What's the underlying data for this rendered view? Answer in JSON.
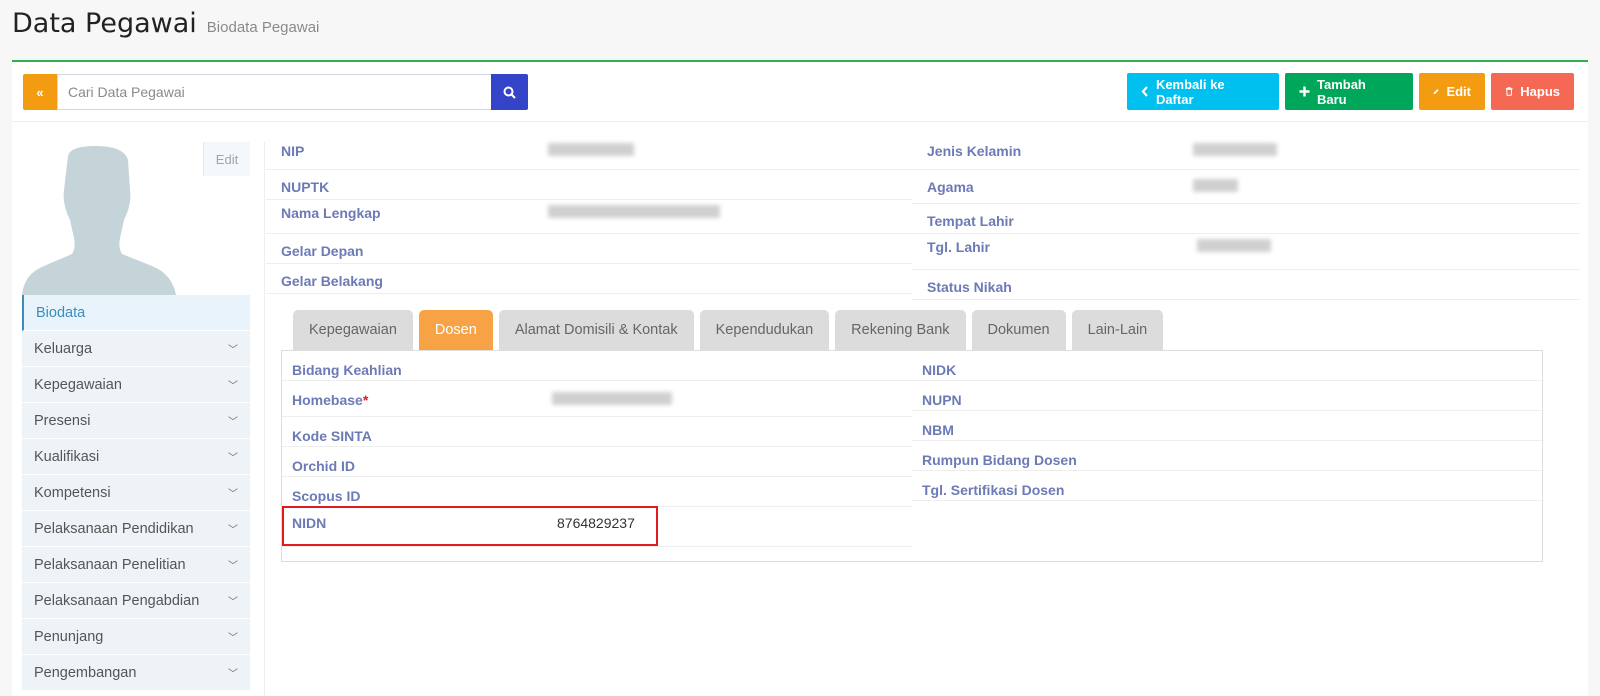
{
  "header": {
    "title": "Data Pegawai",
    "subtitle": "Biodata Pegawai"
  },
  "toolbar": {
    "collapse_label": "«",
    "search_placeholder": "Cari Data Pegawai",
    "back_label": "Kembali ke Daftar",
    "add_label": "Tambah Baru",
    "edit_label": "Edit",
    "delete_label": "Hapus"
  },
  "colors": {
    "accent": "#2fb14f",
    "cyan": "#00c0ef",
    "green": "#00a65a",
    "orange": "#f39c12",
    "red": "#f56954",
    "search": "#3444c8",
    "active_tab": "#f7a245"
  },
  "sidebar": {
    "avatar_edit": "Edit",
    "items": [
      {
        "label": "Biodata"
      },
      {
        "label": "Keluarga"
      },
      {
        "label": "Kepegawaian"
      },
      {
        "label": "Presensi"
      },
      {
        "label": "Kualifikasi"
      },
      {
        "label": "Kompetensi"
      },
      {
        "label": "Pelaksanaan Pendidikan"
      },
      {
        "label": "Pelaksanaan Penelitian"
      },
      {
        "label": "Pelaksanaan Pengabdian"
      },
      {
        "label": "Penunjang"
      },
      {
        "label": "Pengembangan"
      }
    ]
  },
  "info": {
    "left": [
      "NIP",
      "NUPTK",
      "Nama Lengkap",
      "Gelar Depan",
      "Gelar Belakang"
    ],
    "right": [
      "Jenis Kelamin",
      "Agama",
      "Tempat Lahir",
      "Tgl. Lahir",
      "Status Nikah"
    ]
  },
  "tabs": [
    "Kepegawaian",
    "Dosen",
    "Alamat Domisili & Kontak",
    "Kependudukan",
    "Rekening Bank",
    "Dokumen",
    "Lain-Lain"
  ],
  "dosen": {
    "left": [
      {
        "label": "Bidang Keahlian",
        "value": ""
      },
      {
        "label": "Homebase",
        "value": ""
      },
      {
        "label": "Kode SINTA",
        "value": ""
      },
      {
        "label": "Orchid ID",
        "value": ""
      },
      {
        "label": "Scopus ID",
        "value": ""
      },
      {
        "label": "NIDN",
        "value": "8764829237"
      }
    ],
    "right": [
      {
        "label": "NIDK",
        "value": ""
      },
      {
        "label": "NUPN",
        "value": ""
      },
      {
        "label": "NBM",
        "value": ""
      },
      {
        "label": "Rumpun Bidang Dosen",
        "value": ""
      },
      {
        "label": "Tgl. Sertifikasi Dosen",
        "value": ""
      }
    ]
  },
  "icons": {
    "collapse": "double-chevron-left-icon",
    "search": "search-icon",
    "back": "chevron-left-icon",
    "add": "plus-icon",
    "edit": "pencil-icon",
    "delete": "trash-icon"
  }
}
